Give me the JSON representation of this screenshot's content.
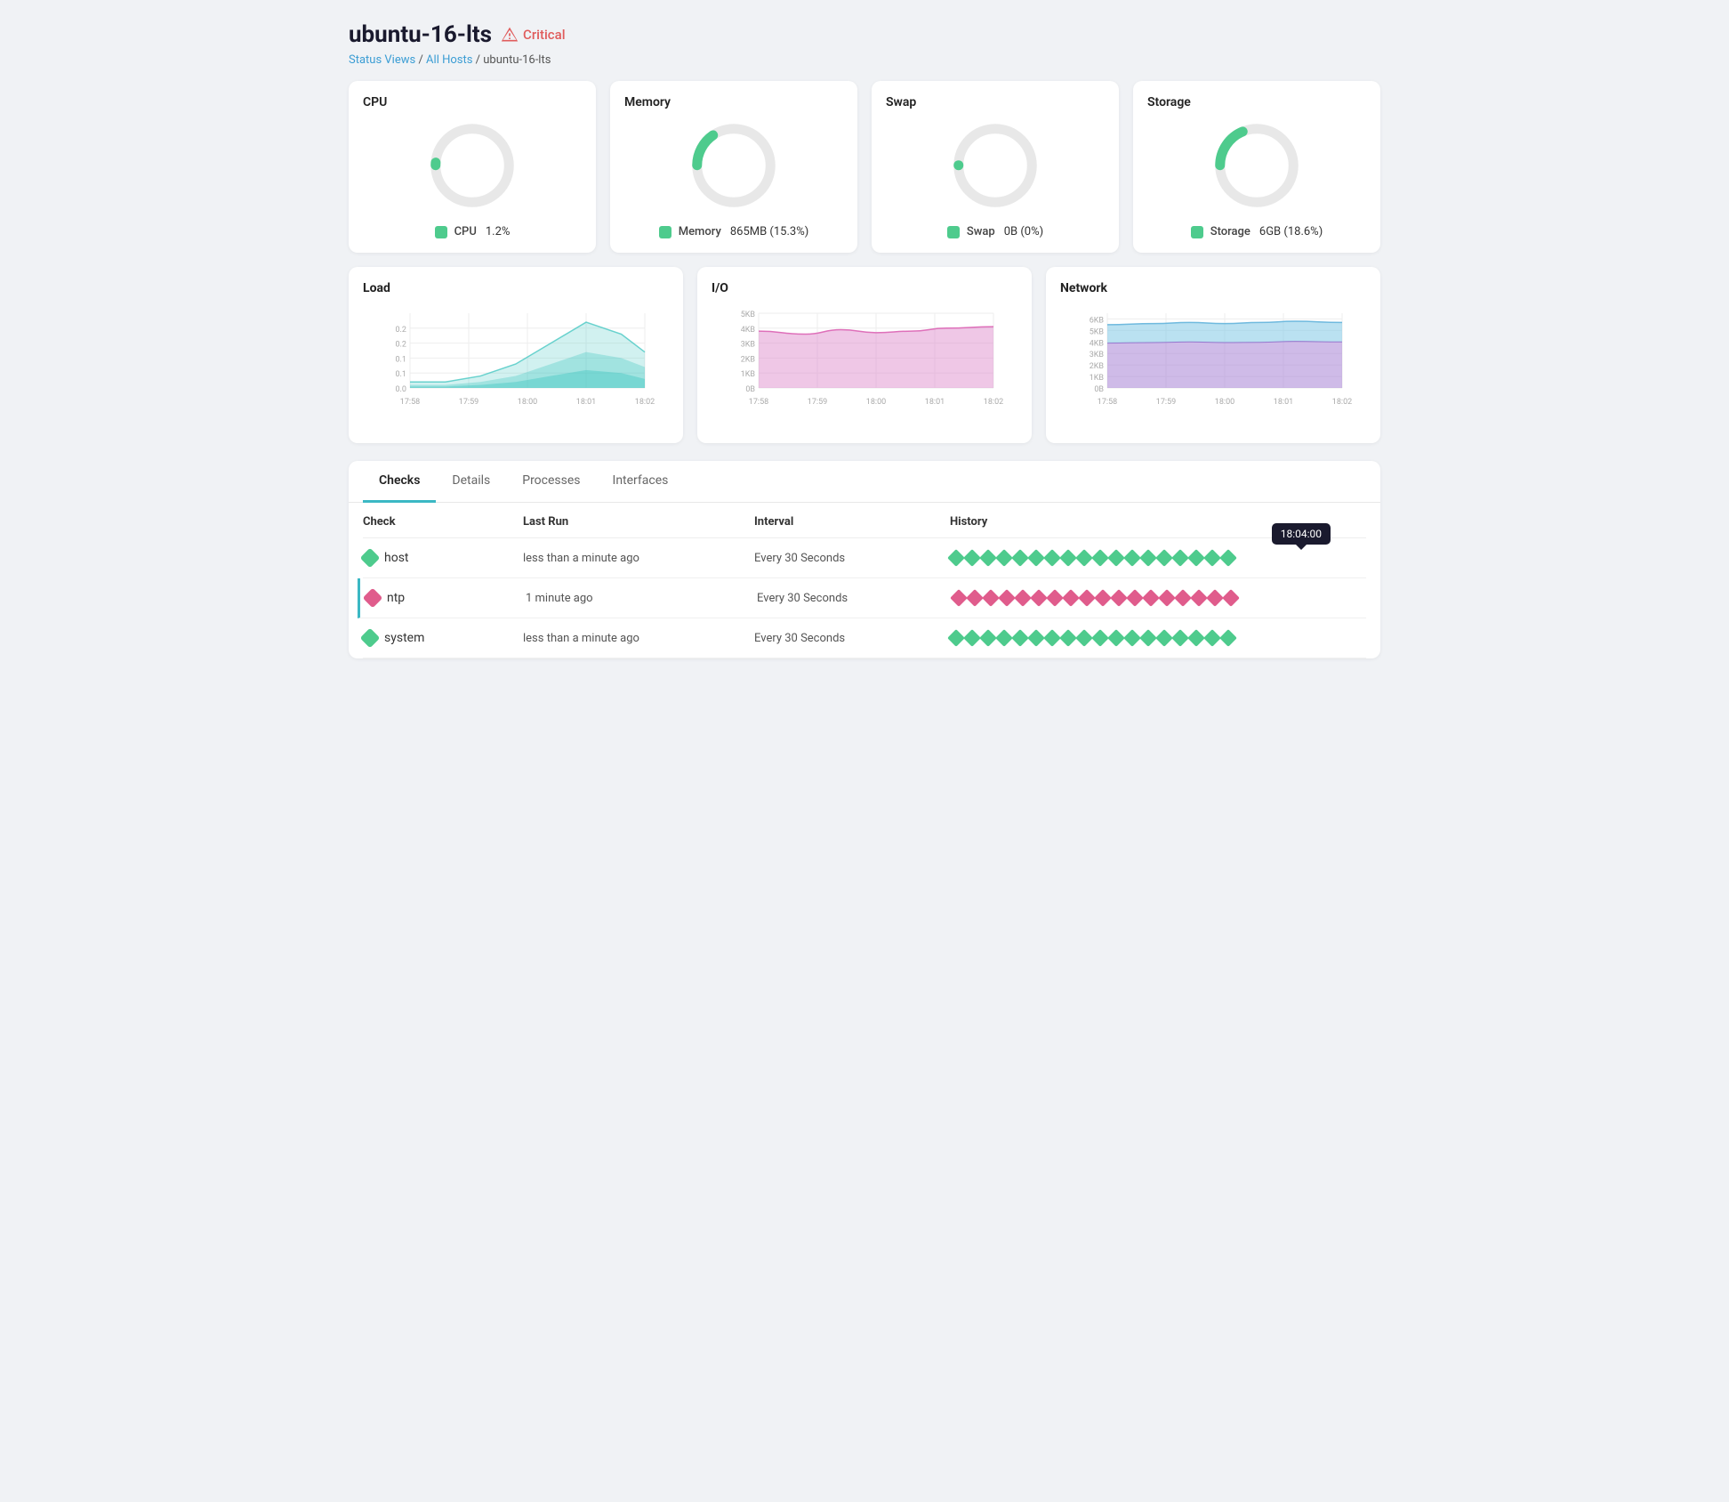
{
  "header": {
    "title": "ubuntu-16-lts",
    "status": "Critical",
    "breadcrumb": {
      "status_views": "Status Views",
      "all_hosts": "All Hosts",
      "current": "ubuntu-16-lts",
      "separator": "/"
    }
  },
  "metrics": [
    {
      "id": "cpu",
      "title": "CPU",
      "label": "CPU",
      "value": "1.2%",
      "percent": 1.2,
      "color": "#4ecb8d"
    },
    {
      "id": "memory",
      "title": "Memory",
      "label": "Memory",
      "value": "865MB (15.3%)",
      "percent": 15.3,
      "color": "#4ecb8d"
    },
    {
      "id": "swap",
      "title": "Swap",
      "label": "Swap",
      "value": "0B (0%)",
      "percent": 0,
      "color": "#4ecb8d"
    },
    {
      "id": "storage",
      "title": "Storage",
      "label": "Storage",
      "value": "6GB (18.6%)",
      "percent": 18.6,
      "color": "#4ecb8d"
    }
  ],
  "charts": [
    {
      "id": "load",
      "title": "Load",
      "y_labels": [
        "0.2",
        "0.2",
        "0.1",
        "0.1",
        "0.0"
      ],
      "x_labels": [
        "17:58",
        "17:59",
        "18:00",
        "18:01",
        "18:02"
      ],
      "type": "load"
    },
    {
      "id": "io",
      "title": "I/O",
      "y_labels": [
        "5KB",
        "4KB",
        "3KB",
        "2KB",
        "1KB",
        "0B"
      ],
      "x_labels": [
        "17:58",
        "17:59",
        "18:00",
        "18:01",
        "18:02"
      ],
      "type": "io"
    },
    {
      "id": "network",
      "title": "Network",
      "y_labels": [
        "6KB",
        "5KB",
        "4KB",
        "3KB",
        "2KB",
        "1KB",
        "0B"
      ],
      "x_labels": [
        "17:58",
        "17:59",
        "18:00",
        "18:01",
        "18:02"
      ],
      "type": "network"
    }
  ],
  "tabs": [
    {
      "id": "checks",
      "label": "Checks",
      "active": true
    },
    {
      "id": "details",
      "label": "Details",
      "active": false
    },
    {
      "id": "processes",
      "label": "Processes",
      "active": false
    },
    {
      "id": "interfaces",
      "label": "Interfaces",
      "active": false
    }
  ],
  "table": {
    "headers": {
      "check": "Check",
      "last_run": "Last Run",
      "interval": "Interval",
      "history": "History"
    },
    "rows": [
      {
        "name": "host",
        "status": "green",
        "last_run": "less than a minute ago",
        "interval": "Every 30 Seconds",
        "history_count": 18,
        "history_status": "green",
        "tooltip": "18:04:00",
        "show_tooltip": true,
        "highlight": false
      },
      {
        "name": "ntp",
        "status": "pink",
        "last_run": "1 minute ago",
        "interval": "Every 30 Seconds",
        "history_count": 18,
        "history_status": "pink",
        "tooltip": null,
        "show_tooltip": false,
        "highlight": true
      },
      {
        "name": "system",
        "status": "green",
        "last_run": "less than a minute ago",
        "interval": "Every 30 Seconds",
        "history_count": 18,
        "history_status": "green",
        "tooltip": null,
        "show_tooltip": false,
        "highlight": false
      }
    ]
  }
}
